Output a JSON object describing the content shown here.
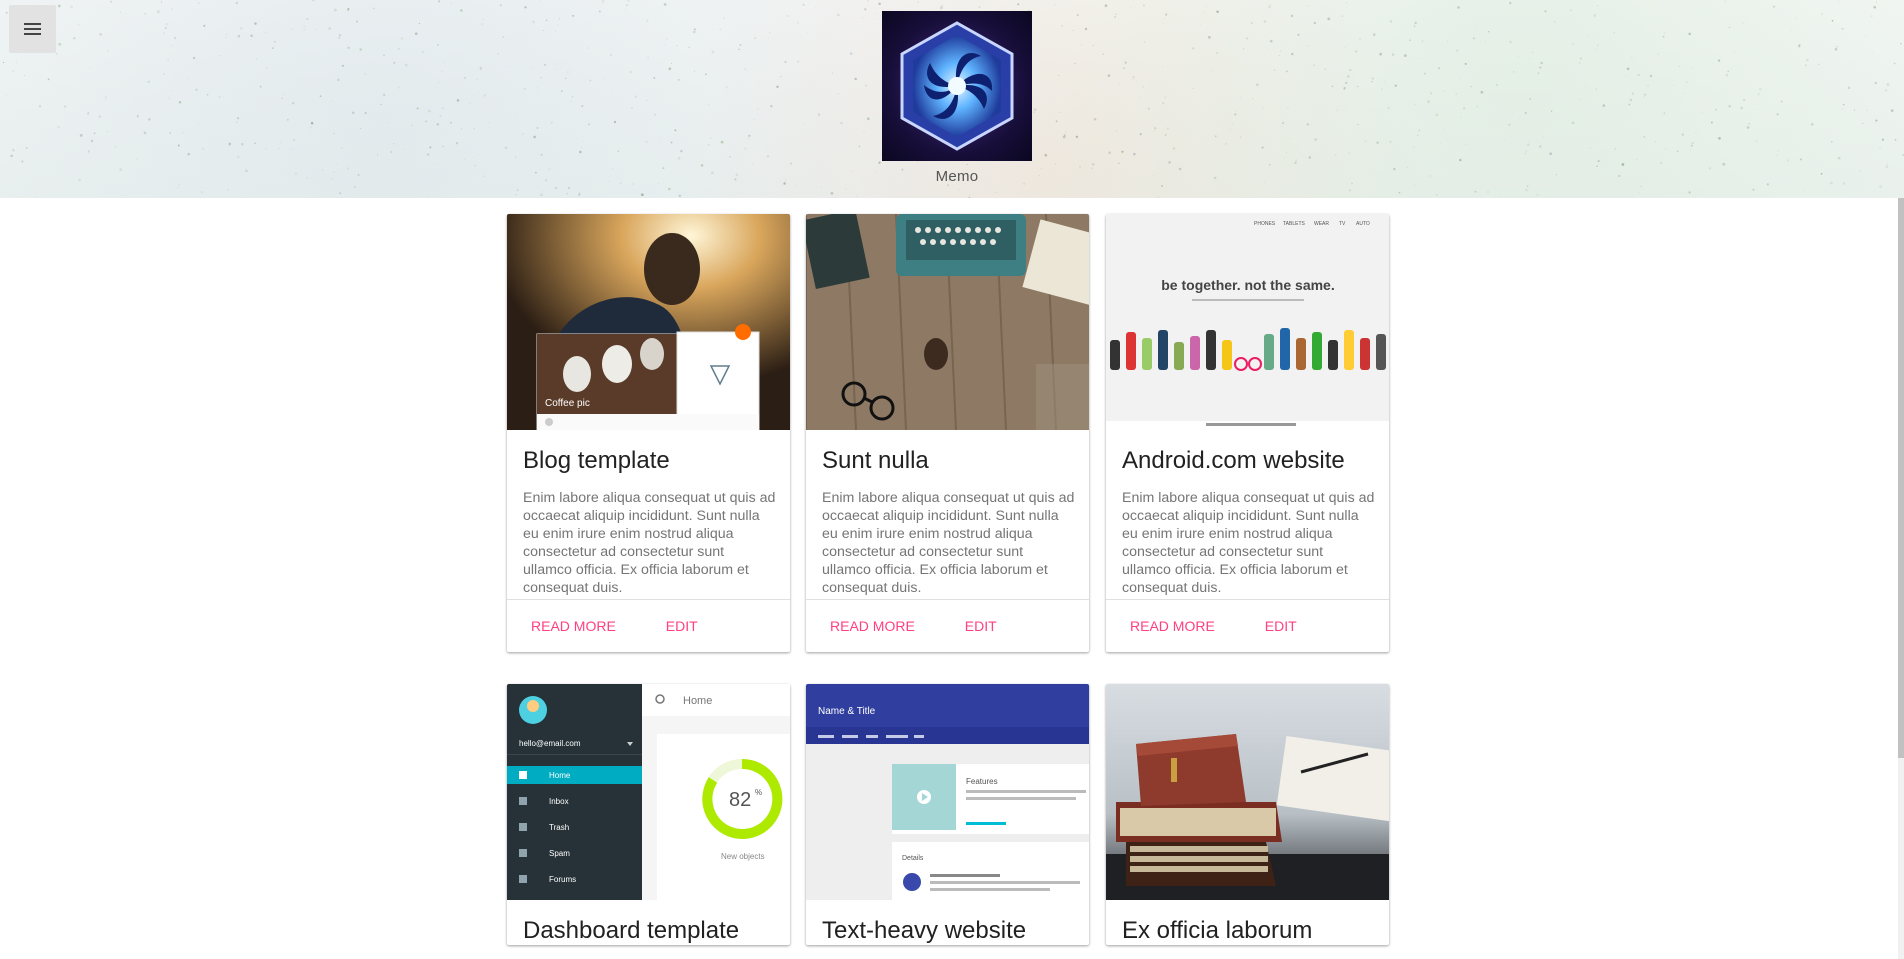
{
  "header": {
    "menu_icon": "hamburger-menu-icon",
    "logo_name": "Memo",
    "colors": {
      "accent": "#ff4081",
      "logo_bg": "#1b1040"
    }
  },
  "cards": [
    {
      "title": "Blog template",
      "body": "Enim labore aliqua consequat ut quis ad occaecat aliquip incididunt. Sunt nulla eu enim irure enim nostrud aliqua consectetur ad consectetur sunt ullamco officia. Ex officia laborum et consequat duis.",
      "read_more": "Read more",
      "edit": "Edit",
      "image_caption": "Coffee pic"
    },
    {
      "title": "Sunt nulla",
      "body": "Enim labore aliqua consequat ut quis ad occaecat aliquip incididunt. Sunt nulla eu enim irure enim nostrud aliqua consectetur ad consectetur sunt ullamco officia. Ex officia laborum et consequat duis.",
      "read_more": "Read more",
      "edit": "Edit"
    },
    {
      "title": "Android.com website",
      "body": "Enim labore aliqua consequat ut quis ad occaecat aliquip incididunt. Sunt nulla eu enim irure enim nostrud aliqua consectetur ad consectetur sunt ullamco officia. Ex officia laborum et consequat duis.",
      "read_more": "Read more",
      "edit": "Edit",
      "image_headline": "be together. not the same.",
      "image_nav": [
        "PHONES",
        "TABLETS",
        "WEAR",
        "TV",
        "AUTO"
      ]
    },
    {
      "title": "Dashboard template",
      "image_email": "hello@email.com",
      "image_nav": [
        "Home",
        "Inbox",
        "Trash",
        "Spam",
        "Forums"
      ],
      "image_search": "Home",
      "image_gauge_value": "82",
      "image_gauge_unit": "%",
      "image_gauge_label": "New objects"
    },
    {
      "title": "Text-heavy website",
      "image_header": "Name & Title",
      "image_section1": "Features",
      "image_section2": "Details"
    },
    {
      "title": "Ex officia laborum"
    }
  ]
}
